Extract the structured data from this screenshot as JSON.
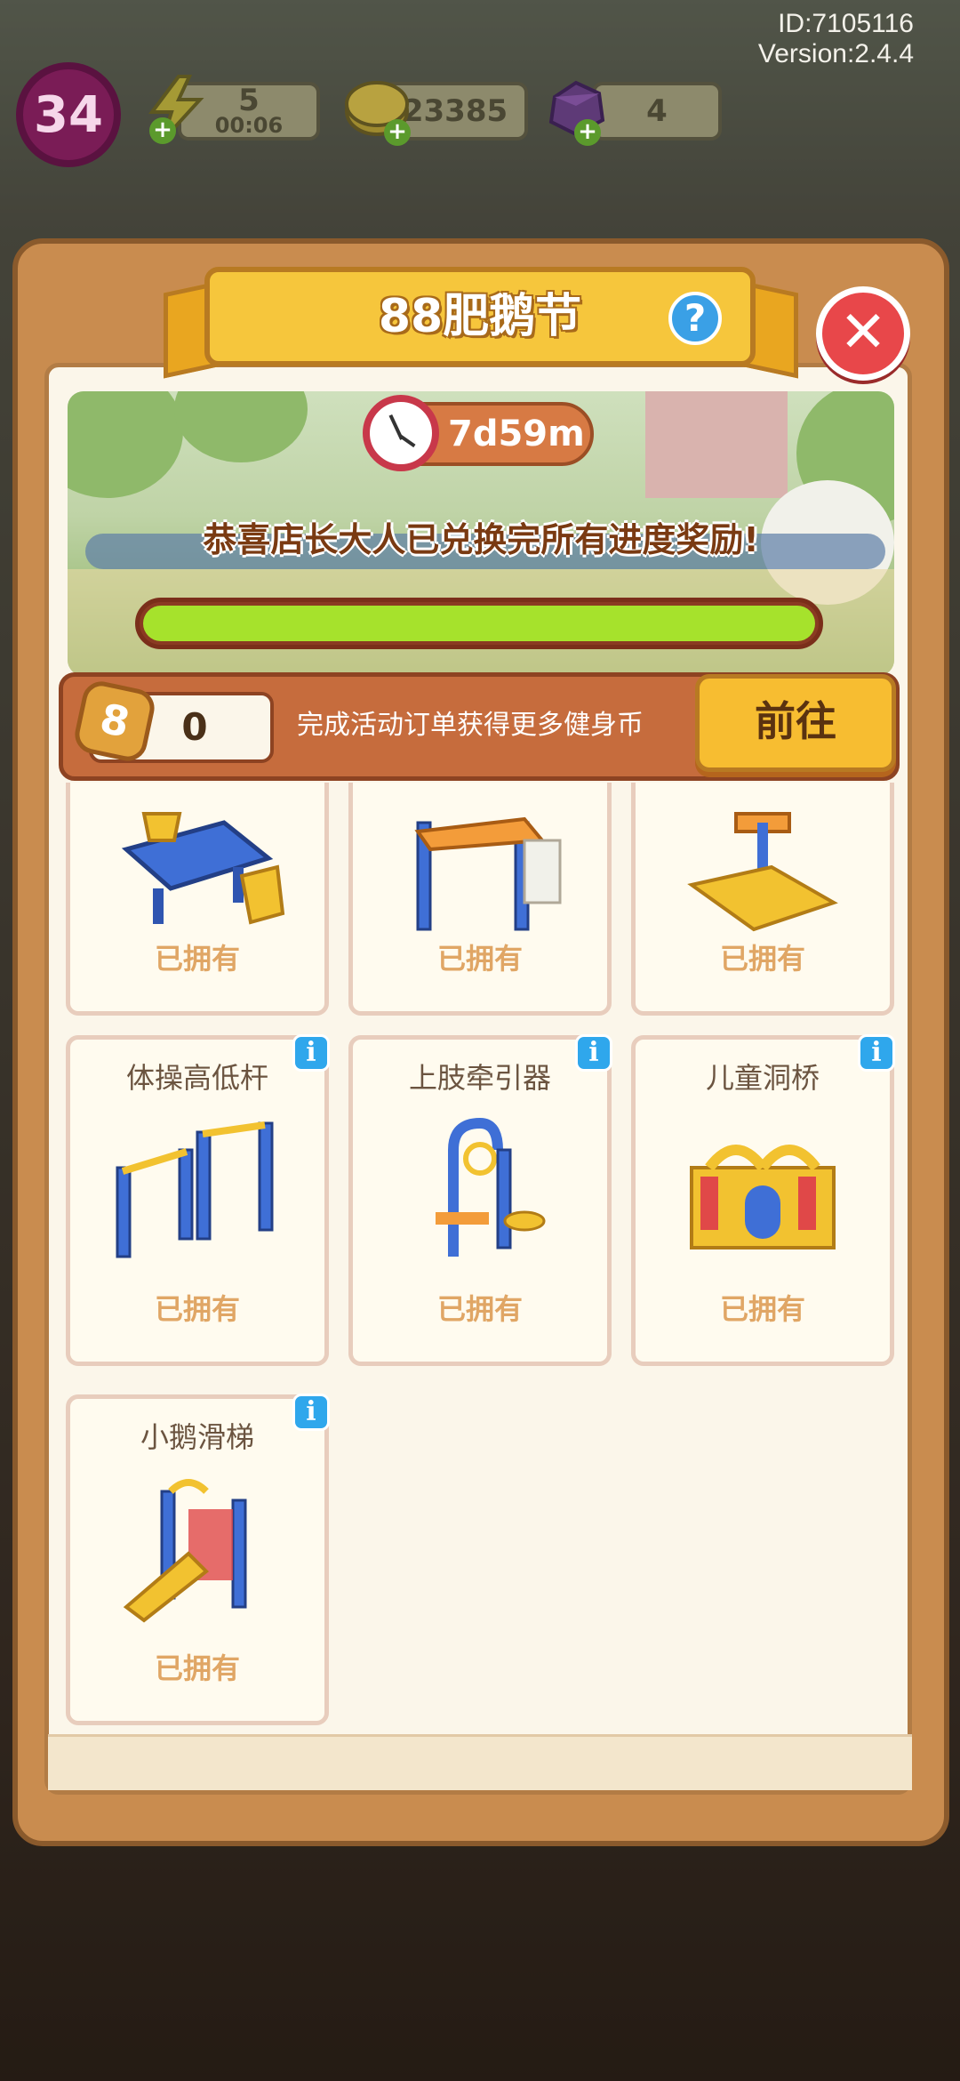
{
  "hud": {
    "player_id": "ID:7105116",
    "version": "Version:2.4.4",
    "level": "34",
    "energy": {
      "value": "5",
      "timer": "00:06",
      "icon": "lightning-icon"
    },
    "coins": {
      "value": "23385",
      "icon": "coin-icon"
    },
    "gems": {
      "value": "4",
      "icon": "gem-icon"
    }
  },
  "event": {
    "title": "88肥鹅节",
    "help_icon": "?",
    "close_icon": "✕",
    "timer": "7d59m",
    "congrats": "恭喜店长大人已兑换完所有进度奖励!",
    "progress": 1.0
  },
  "coinbar": {
    "coin_glyph": "8",
    "coin_count": "0",
    "description": "完成活动订单获得更多健身币",
    "go_label": "前往"
  },
  "items": [
    {
      "name": "",
      "status": "已拥有",
      "icon": "chess-table-icon"
    },
    {
      "name": "",
      "status": "已拥有",
      "icon": "climbing-frame-icon"
    },
    {
      "name": "",
      "status": "已拥有",
      "icon": "seesaw-icon"
    },
    {
      "name": "体操高低杆",
      "status": "已拥有",
      "icon": "parallel-bars-icon",
      "info": "i"
    },
    {
      "name": "上肢牵引器",
      "status": "已拥有",
      "icon": "pull-machine-icon",
      "info": "i"
    },
    {
      "name": "儿童洞桥",
      "status": "已拥有",
      "icon": "tunnel-bridge-icon",
      "info": "i"
    },
    {
      "name": "小鹅滑梯",
      "status": "已拥有",
      "icon": "slide-icon",
      "info": "i"
    }
  ],
  "colors": {
    "panel": "#c98c4f",
    "banner": "#f6c63c",
    "progress": "#a6e22c",
    "owned_text": "#e0a665"
  }
}
